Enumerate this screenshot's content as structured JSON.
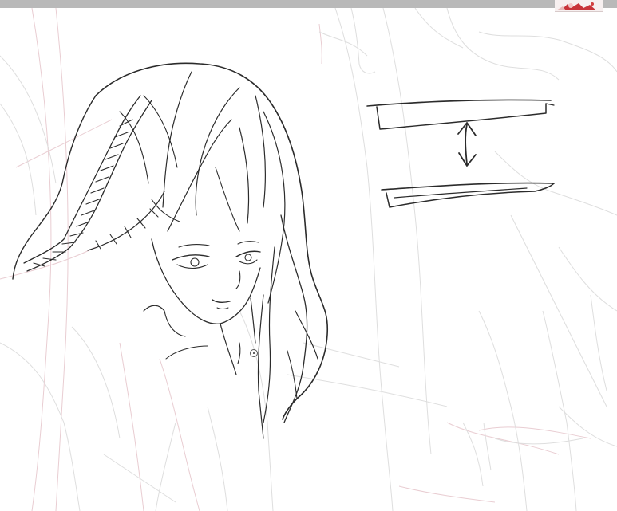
{
  "window": {
    "title_bar_color": "#b9b9b9"
  },
  "canvas": {
    "background": "#ffffff",
    "line_color": "#2b2b2b",
    "sketch_pink": "#e6c6cc",
    "sketch_gray": "#d6d6d6"
  },
  "icons": {
    "thumbnail": "navigator-thumbnail-icon",
    "cursor": "brush-cursor-icon",
    "arrow": "double-headed-arrow-icon"
  }
}
